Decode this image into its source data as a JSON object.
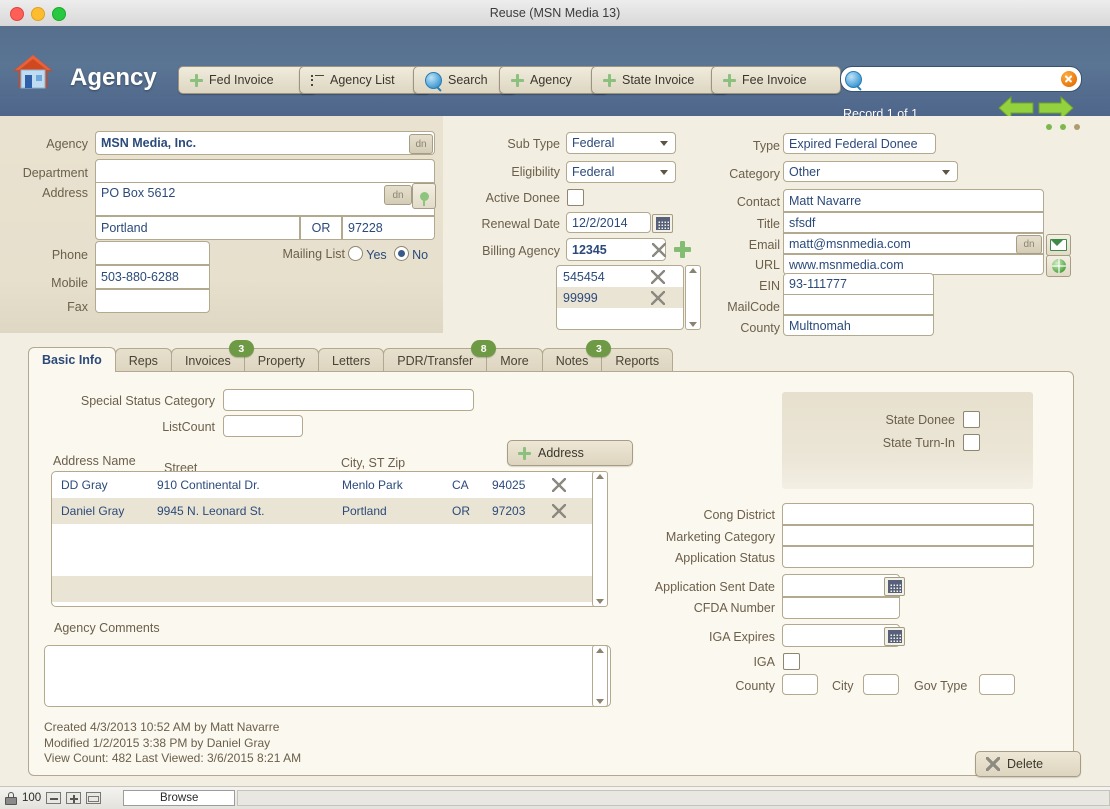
{
  "window": {
    "title": "Reuse (MSN Media 13)"
  },
  "header": {
    "app_title": "Agency",
    "logo_icon": "house-icon",
    "record_status": "Record 1 of 1",
    "search": {
      "value": "",
      "placeholder": ""
    },
    "buttons": [
      {
        "label": "Fed Invoice",
        "icon": "plus-icon"
      },
      {
        "label": "Agency List",
        "icon": "list-icon"
      },
      {
        "label": "Search",
        "icon": "magnifier-icon"
      },
      {
        "label": "Agency",
        "icon": "plus-icon"
      },
      {
        "label": "State Invoice",
        "icon": "plus-icon"
      },
      {
        "label": "Fee Invoice",
        "icon": "plus-icon"
      }
    ],
    "nav": {
      "prev_icon": "arrow-left-icon",
      "next_icon": "arrow-right-icon"
    }
  },
  "form": {
    "left": {
      "agency_label": "Agency",
      "agency_value": "MSN Media, Inc.",
      "agency_dn": "dn",
      "department_label": "Department",
      "department_value": "",
      "address_label": "Address",
      "address_value": "PO Box 5612",
      "address_dn": "dn",
      "city_value": "Portland",
      "state_value": "OR",
      "zip_value": "97228",
      "phone_label": "Phone",
      "phone_value": "",
      "mobile_label": "Mobile",
      "mobile_value": "503-880-6288",
      "fax_label": "Fax",
      "fax_value": "",
      "mailing_list_label": "Mailing List",
      "mailing_yes": "Yes",
      "mailing_no": "No",
      "mailing_selected": "No"
    },
    "middle": {
      "sub_type_label": "Sub Type",
      "sub_type_value": "Federal",
      "eligibility_label": "Eligibility",
      "eligibility_value": "Federal",
      "active_donee_label": "Active Donee",
      "active_donee_checked": false,
      "renewal_date_label": "Renewal Date",
      "renewal_date_value": "12/2/2014",
      "billing_agency_label": "Billing Agency",
      "billing_agency_value": "12345",
      "billing_agency_list": [
        "545454",
        "99999"
      ]
    },
    "right": {
      "type_label": "Type",
      "type_value": "Expired Federal Donee",
      "category_label": "Category",
      "category_value": "Other",
      "contact_label": "Contact",
      "contact_value": "Matt Navarre",
      "title_label": "Title",
      "title_value": "sfsdf",
      "email_label": "Email",
      "email_value": "matt@msnmedia.com",
      "email_dn": "dn",
      "url_label": "URL",
      "url_value": "www.msnmedia.com",
      "ein_label": "EIN",
      "ein_value": "93-111777",
      "mailcode_label": "MailCode",
      "mailcode_value": "",
      "county_label": "County",
      "county_value": "Multnomah"
    }
  },
  "tabs": [
    {
      "label": "Basic Info",
      "active": true,
      "badge": null
    },
    {
      "label": "Reps",
      "active": false,
      "badge": null
    },
    {
      "label": "Invoices",
      "active": false,
      "badge": "3"
    },
    {
      "label": "Property",
      "active": false,
      "badge": null
    },
    {
      "label": "Letters",
      "active": false,
      "badge": null
    },
    {
      "label": "PDR/Transfer",
      "active": false,
      "badge": "8"
    },
    {
      "label": "More",
      "active": false,
      "badge": null
    },
    {
      "label": "Notes",
      "active": false,
      "badge": "3"
    },
    {
      "label": "Reports",
      "active": false,
      "badge": null
    }
  ],
  "basic_info": {
    "special_status_label": "Special Status Category",
    "special_status_value": "",
    "listcount_label": "ListCount",
    "listcount_value": "",
    "address_button": "Address",
    "grid_headers": [
      "Address Name",
      "Street",
      "City, ST Zip"
    ],
    "grid_rows": [
      {
        "name": "DD Gray",
        "street": "910 Continental Dr.",
        "city": "Menlo Park",
        "state": "CA",
        "zip": "94025"
      },
      {
        "name": "Daniel Gray",
        "street": "9945 N. Leonard St.",
        "city": "Portland",
        "state": "OR",
        "zip": "97203"
      }
    ],
    "comments_label": "Agency Comments",
    "comments_value": "",
    "created_line": "Created 4/3/2013 10:52 AM by Matt Navarre",
    "modified_line": "Modified 1/2/2015 3:38 PM by Daniel Gray",
    "viewed_line": "View Count: 482  Last Viewed: 3/6/2015 8:21 AM",
    "state_donee_label": "State Donee",
    "state_donee_checked": false,
    "state_turnin_label": "State Turn-In",
    "state_turnin_checked": false,
    "cong_district_label": "Cong District",
    "cong_district_value": "",
    "marketing_category_label": "Marketing Category",
    "marketing_category_value": "",
    "application_status_label": "Application Status",
    "application_status_value": "",
    "application_sent_label": "Application Sent Date",
    "application_sent_value": "",
    "cfda_label": "CFDA Number",
    "cfda_value": "",
    "iga_expires_label": "IGA Expires",
    "iga_expires_value": "",
    "iga_label": "IGA",
    "iga_checked": false,
    "county_label": "County",
    "county_value": "",
    "city_label": "City",
    "city_value": "",
    "gov_type_label": "Gov Type",
    "gov_type_value": "",
    "delete_button": "Delete"
  },
  "statusbar": {
    "zoom_value": "100",
    "mode": "Browse",
    "lock_icon": "lock-icon",
    "zoom_out_icon": "zoom-out-icon",
    "zoom_in_icon": "zoom-in-icon",
    "window_icon": "window-toggle-icon"
  },
  "colors": {
    "header_blue": "#5a7494",
    "panel_beige": "#e9e2d0",
    "body_beige": "#f2eee2",
    "badge_green": "#6f9a45",
    "field_text_blue": "#2b4a7a",
    "label_brown": "#6b5f4a",
    "accent_green": "#8cc07e",
    "clear_orange": "#e8760f"
  }
}
